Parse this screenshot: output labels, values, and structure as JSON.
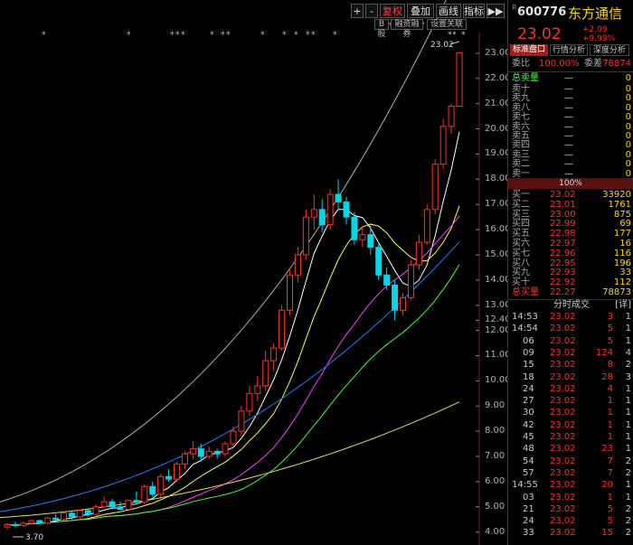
{
  "toolbar": {
    "plus": "+",
    "minus": "-",
    "restore": "复权",
    "overlay": "叠加",
    "stats": "画线",
    "index": "指标",
    "expand": "▶▶",
    "bshare": "B股",
    "margin": "融资融券",
    "settings": "设置关联"
  },
  "stock": {
    "code": "600776",
    "name": "东方通信",
    "price": "23.02",
    "change": "+2.09",
    "change_pct": "+9.99%"
  },
  "tabs": [
    "标准盘口",
    "行情分析",
    "深度分析"
  ],
  "weibi": {
    "label1": "委比",
    "value1": "100.00%",
    "label2": "委差",
    "value2": "78874"
  },
  "asks": {
    "total_label": "总卖量",
    "levels": [
      {
        "label": "卖十",
        "price": "—",
        "vol": "0"
      },
      {
        "label": "卖九",
        "price": "—",
        "vol": "0"
      },
      {
        "label": "卖八",
        "price": "—",
        "vol": "0"
      },
      {
        "label": "卖七",
        "price": "—",
        "vol": "0"
      },
      {
        "label": "卖六",
        "price": "—",
        "vol": "0"
      },
      {
        "label": "卖五",
        "price": "—",
        "vol": "0"
      },
      {
        "label": "卖四",
        "price": "—",
        "vol": "0"
      },
      {
        "label": "卖三",
        "price": "—",
        "vol": "0"
      },
      {
        "label": "卖二",
        "price": "—",
        "vol": "0"
      },
      {
        "label": "卖一",
        "price": "—",
        "vol": "0"
      }
    ],
    "total_price": "—",
    "total_vol": "0"
  },
  "bar_pct": "100%",
  "bids": {
    "levels": [
      {
        "label": "买一",
        "price": "23.02",
        "vol": "33920"
      },
      {
        "label": "买二",
        "price": "23.01",
        "vol": "1761"
      },
      {
        "label": "买三",
        "price": "23.00",
        "vol": "875"
      },
      {
        "label": "买四",
        "price": "22.99",
        "vol": "69"
      },
      {
        "label": "买五",
        "price": "22.98",
        "vol": "177"
      },
      {
        "label": "买六",
        "price": "22.97",
        "vol": "16"
      },
      {
        "label": "买七",
        "price": "22.96",
        "vol": "116"
      },
      {
        "label": "买八",
        "price": "22.95",
        "vol": "196"
      },
      {
        "label": "买九",
        "price": "22.93",
        "vol": "33"
      },
      {
        "label": "买十",
        "price": "22.92",
        "vol": "112"
      }
    ],
    "total_label": "总买量",
    "total_price": "22.27",
    "total_vol": "78873"
  },
  "trades_header": {
    "title": "分时成交",
    "right": "[详]"
  },
  "trades": [
    {
      "time": "14:53",
      "price": "23.02",
      "vol": "3",
      "n": "1"
    },
    {
      "time": "14:54",
      "price": "23.02",
      "vol": "5",
      "n": "1"
    },
    {
      "time": "06",
      "price": "23.02",
      "vol": "5",
      "n": "1"
    },
    {
      "time": "09",
      "price": "23.02",
      "vol": "124",
      "n": "4"
    },
    {
      "time": "15",
      "price": "23.02",
      "vol": "8",
      "n": "2"
    },
    {
      "time": "18",
      "price": "23.02",
      "vol": "28",
      "n": "3"
    },
    {
      "time": "24",
      "price": "23.02",
      "vol": "4",
      "n": "1"
    },
    {
      "time": "27",
      "price": "23.02",
      "vol": "1",
      "n": "1"
    },
    {
      "time": "30",
      "price": "23.02",
      "vol": "1",
      "n": "1"
    },
    {
      "time": "42",
      "price": "23.02",
      "vol": "1",
      "n": "1"
    },
    {
      "time": "45",
      "price": "23.02",
      "vol": "1",
      "n": "1"
    },
    {
      "time": "48",
      "price": "23.02",
      "vol": "23",
      "n": "1"
    },
    {
      "time": "54",
      "price": "23.02",
      "vol": "7",
      "n": "2"
    },
    {
      "time": "57",
      "price": "23.02",
      "vol": "7",
      "n": "2"
    },
    {
      "time": "14:55",
      "price": "23.02",
      "vol": "20",
      "n": "1"
    },
    {
      "time": "03",
      "price": "23.02",
      "vol": "1",
      "n": "1"
    },
    {
      "time": "21",
      "price": "23.02",
      "vol": "5",
      "n": "2"
    },
    {
      "time": "24",
      "price": "23.02",
      "vol": "5",
      "n": "2"
    },
    {
      "time": "33",
      "price": "23.02",
      "vol": "15",
      "n": "2"
    }
  ],
  "chart_data": {
    "type": "candlestick",
    "y_ticks": [
      "23.00",
      "22.00",
      "21.00",
      "20.00",
      "19.00",
      "18.00",
      "17.00",
      "16.00",
      "15.00",
      "14.00",
      "13.00",
      "12.40",
      "12.00",
      "11.00",
      "10.00",
      "9.00",
      "8.00",
      "7.00",
      "6.00",
      "5.00",
      "4.00"
    ],
    "ylim": [
      3.7,
      23.5
    ],
    "high_label": "23.02",
    "low_label": "3.70",
    "colors": {
      "up": "#ff3030",
      "down": "#00d8e8",
      "ma5": "#ffffff",
      "ma10": "#ffff40",
      "ma20": "#ff40ff",
      "ma30": "#40ff40",
      "ma60": "#b0b0b0",
      "ma120": "#2080ff",
      "ma250": "#e0e060"
    },
    "candles": [
      [
        4.2,
        4.35,
        4.1,
        4.3
      ],
      [
        4.3,
        4.4,
        4.2,
        4.25
      ],
      [
        4.25,
        4.4,
        4.2,
        4.35
      ],
      [
        4.35,
        4.5,
        4.3,
        4.45
      ],
      [
        4.45,
        4.5,
        4.3,
        4.35
      ],
      [
        4.35,
        4.6,
        4.3,
        4.55
      ],
      [
        4.55,
        4.7,
        4.45,
        4.5
      ],
      [
        4.5,
        4.8,
        4.45,
        4.75
      ],
      [
        4.75,
        4.8,
        4.5,
        4.6
      ],
      [
        4.6,
        4.9,
        4.55,
        4.85
      ],
      [
        4.85,
        4.95,
        4.6,
        4.7
      ],
      [
        4.7,
        5.1,
        4.65,
        5.0
      ],
      [
        5.0,
        5.4,
        4.95,
        5.2
      ],
      [
        5.2,
        5.3,
        4.9,
        5.0
      ],
      [
        5.0,
        5.2,
        4.85,
        4.9
      ],
      [
        4.9,
        5.3,
        4.85,
        5.25
      ],
      [
        5.25,
        5.6,
        5.1,
        5.2
      ],
      [
        5.2,
        5.9,
        5.1,
        5.8
      ],
      [
        5.8,
        6.0,
        5.4,
        5.5
      ],
      [
        5.5,
        6.3,
        5.4,
        6.2
      ],
      [
        6.2,
        6.5,
        6.0,
        6.1
      ],
      [
        6.1,
        6.8,
        6.0,
        6.7
      ],
      [
        6.7,
        7.2,
        6.5,
        7.1
      ],
      [
        7.1,
        7.6,
        6.9,
        7.3
      ],
      [
        7.3,
        7.5,
        6.8,
        7.0
      ],
      [
        7.0,
        7.4,
        6.9,
        7.2
      ],
      [
        7.2,
        7.3,
        6.9,
        7.1
      ],
      [
        7.1,
        7.6,
        7.0,
        7.5
      ],
      [
        7.5,
        8.2,
        7.4,
        8.0
      ],
      [
        8.0,
        9.0,
        7.8,
        8.8
      ],
      [
        8.8,
        9.8,
        8.6,
        9.5
      ],
      [
        9.5,
        10.2,
        9.2,
        9.8
      ],
      [
        9.8,
        11.2,
        9.6,
        10.8
      ],
      [
        10.8,
        11.5,
        10.4,
        11.3
      ],
      [
        11.3,
        13.0,
        11.2,
        12.8
      ],
      [
        12.8,
        14.4,
        12.6,
        14.2
      ],
      [
        14.2,
        15.3,
        13.9,
        15.0
      ],
      [
        15.0,
        16.8,
        14.8,
        16.5
      ],
      [
        16.5,
        17.4,
        16.0,
        16.8
      ],
      [
        16.8,
        17.2,
        15.9,
        16.2
      ],
      [
        16.2,
        17.6,
        16.0,
        17.4
      ],
      [
        17.4,
        18.0,
        16.8,
        17.1
      ],
      [
        17.1,
        17.3,
        16.2,
        16.5
      ],
      [
        16.5,
        16.7,
        15.4,
        15.6
      ],
      [
        15.6,
        16.1,
        15.3,
        15.8
      ],
      [
        15.8,
        16.2,
        15.0,
        15.3
      ],
      [
        15.3,
        15.5,
        14.0,
        14.2
      ],
      [
        14.2,
        14.5,
        13.6,
        13.8
      ],
      [
        13.8,
        14.0,
        12.4,
        12.8
      ],
      [
        12.8,
        13.5,
        12.6,
        13.3
      ],
      [
        13.3,
        14.8,
        13.2,
        14.6
      ],
      [
        14.6,
        15.8,
        14.4,
        15.5
      ],
      [
        15.5,
        17.0,
        15.4,
        16.8
      ],
      [
        16.8,
        18.8,
        16.6,
        18.6
      ],
      [
        18.6,
        20.4,
        18.4,
        20.1
      ],
      [
        20.1,
        21.0,
        19.8,
        20.9
      ],
      [
        20.9,
        23.02,
        20.9,
        23.02
      ]
    ]
  }
}
